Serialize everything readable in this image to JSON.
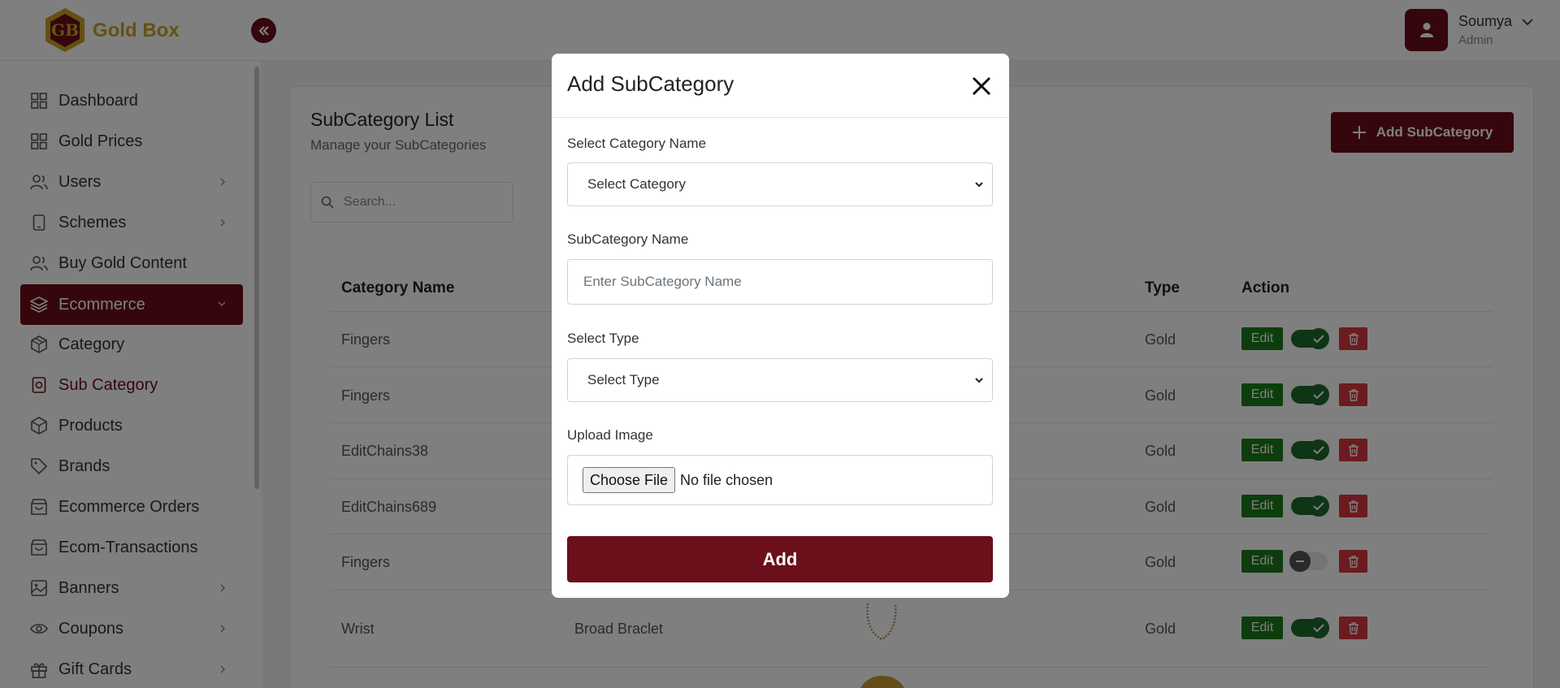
{
  "brand": {
    "name": "Gold Box"
  },
  "user": {
    "name": "Soumya",
    "role": "Admin"
  },
  "sidebar": {
    "items": [
      {
        "label": "Dashboard",
        "icon": "grid-icon"
      },
      {
        "label": "Gold Prices",
        "icon": "grid-icon"
      },
      {
        "label": "Users",
        "icon": "users-icon",
        "has_children": true
      },
      {
        "label": "Schemes",
        "icon": "tablet-icon",
        "has_children": true
      },
      {
        "label": "Buy Gold Content",
        "icon": "users-icon"
      },
      {
        "label": "Ecommerce",
        "icon": "layers-icon",
        "expanded": true,
        "active": true
      },
      {
        "label": "Category",
        "icon": "codesandbox-icon"
      },
      {
        "label": "Sub Category",
        "icon": "image-icon",
        "current": true
      },
      {
        "label": "Products",
        "icon": "box-icon"
      },
      {
        "label": "Brands",
        "icon": "tag-icon"
      },
      {
        "label": "Ecommerce Orders",
        "icon": "shopping-bag-icon"
      },
      {
        "label": "Ecom-Transactions",
        "icon": "shopping-bag-icon"
      },
      {
        "label": "Banners",
        "icon": "image-icon",
        "has_children": true
      },
      {
        "label": "Coupons",
        "icon": "eye-icon",
        "has_children": true
      },
      {
        "label": "Gift Cards",
        "icon": "gift-icon",
        "has_children": true
      }
    ]
  },
  "page": {
    "title": "SubCategory List",
    "subtitle": "Manage your SubCategories",
    "search_placeholder": "Search...",
    "add_button": "Add SubCategory"
  },
  "table": {
    "headers": {
      "category": "Category Name",
      "type": "Type",
      "action": "Action"
    },
    "rows": [
      {
        "category": "Fingers",
        "subcategory": "",
        "type": "Gold",
        "enabled": true
      },
      {
        "category": "Fingers",
        "subcategory": "",
        "type": "Gold",
        "enabled": true
      },
      {
        "category": "EditChains38",
        "subcategory": "",
        "type": "Gold",
        "enabled": true
      },
      {
        "category": "EditChains689",
        "subcategory": "",
        "type": "Gold",
        "enabled": true
      },
      {
        "category": "Fingers",
        "subcategory": "",
        "type": "Gold",
        "enabled": false
      },
      {
        "category": "Wrist",
        "subcategory": "Broad Braclet",
        "type": "Gold",
        "enabled": true
      }
    ],
    "edit_label": "Edit"
  },
  "modal": {
    "title": "Add SubCategory",
    "category_label": "Select Category Name",
    "category_value": "Select Category",
    "name_label": "SubCategory Name",
    "name_placeholder": "Enter SubCategory Name",
    "type_label": "Select Type",
    "type_value": "Select Type",
    "image_label": "Upload Image",
    "choose_file": "Choose File",
    "no_file": "No file chosen",
    "submit": "Add"
  },
  "colors": {
    "primary": "#6b0f1a",
    "gold": "#c9a227",
    "success": "#1a7a1a",
    "danger": "#d9363e"
  }
}
